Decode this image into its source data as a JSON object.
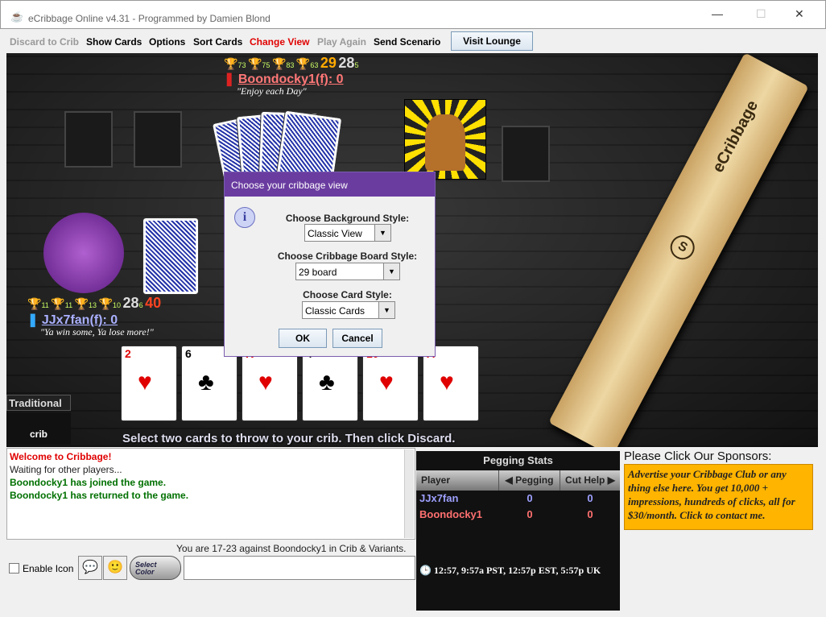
{
  "window": {
    "title": "eCribbage Online v4.31 - Programmed by Damien Blond"
  },
  "menu": [
    {
      "label": "Discard to Crib",
      "state": "disabled"
    },
    {
      "label": "Show Cards",
      "state": "enabled"
    },
    {
      "label": "Options",
      "state": "enabled"
    },
    {
      "label": "Sort Cards",
      "state": "enabled"
    },
    {
      "label": "Change View",
      "state": "active"
    },
    {
      "label": "Play Again",
      "state": "disabled"
    },
    {
      "label": "Send Scenario",
      "state": "enabled"
    }
  ],
  "visit_lounge": "Visit Lounge",
  "opponent": {
    "trophies": [
      "73",
      "75",
      "83",
      "63"
    ],
    "level_a": "29",
    "level_b": "28",
    "level_b_sub": "5",
    "name": "Boondocky1(f): 0",
    "quote": "\"Enjoy each Day\""
  },
  "player": {
    "trophies": [
      "11",
      "11",
      "13",
      "10"
    ],
    "level_a": "28",
    "level_a_sub": "6",
    "level_b": "40",
    "name": "JJx7fan(f): 0",
    "quote": "\"Ya win some, Ya lose more!\""
  },
  "mode_label": "Traditional",
  "crib_logo": "crib",
  "hand": [
    {
      "rank": "2",
      "suit": "♥",
      "color": "#e00000"
    },
    {
      "rank": "6",
      "suit": "♣",
      "color": "#000000"
    },
    {
      "rank": "K",
      "suit": "♥",
      "color": "#e00000"
    },
    {
      "rank": "4",
      "suit": "♣",
      "color": "#000000"
    },
    {
      "rank": "10",
      "suit": "♥",
      "color": "#e00000"
    },
    {
      "rank": "A",
      "suit": "♥",
      "color": "#e00000"
    }
  ],
  "instruction": "Select two cards to throw to your crib. Then click Discard.",
  "board_label": "eCribbage",
  "dialog": {
    "title": "Choose your cribbage view",
    "bg_label": "Choose Background Style:",
    "bg_value": "Classic View",
    "board_label": "Choose Cribbage Board Style:",
    "board_value": "29 board",
    "card_label": "Choose Card Style:",
    "card_value": "Classic Cards",
    "ok": "OK",
    "cancel": "Cancel"
  },
  "chat": [
    {
      "text": "Welcome to Cribbage!",
      "color": "#e00000"
    },
    {
      "text": "Waiting for other players...",
      "color": "#222222"
    },
    {
      "text": "Boondocky1 has joined the game.",
      "color": "#007000"
    },
    {
      "text": "Boondocky1 has returned to the game.",
      "color": "#007000"
    }
  ],
  "record": "You are 17-23 against Boondocky1 in Crib & Variants.",
  "enable_icon": "Enable Icon",
  "select_color": "Select Color",
  "chat_input": "",
  "pegging": {
    "title": "Pegging Stats",
    "headers": [
      "Player",
      "◀ Pegging",
      "Cut Help ▶"
    ],
    "rows": [
      {
        "player": "JJx7fan",
        "pegging": "0",
        "cut": "0",
        "color": "#9ea0ff"
      },
      {
        "player": "Boondocky1",
        "pegging": "0",
        "cut": "0",
        "color": "#ff7070"
      }
    ],
    "clock": "12:57, 9:57a PST, 12:57p EST, 5:57p UK"
  },
  "sponsors": {
    "title": "Please Click Our Sponsors:",
    "text": "Advertise your Cribbage Club or any thing else here. You get 10,000 + impressions, hundreds of clicks, all for $30/month. Click to contact me."
  }
}
